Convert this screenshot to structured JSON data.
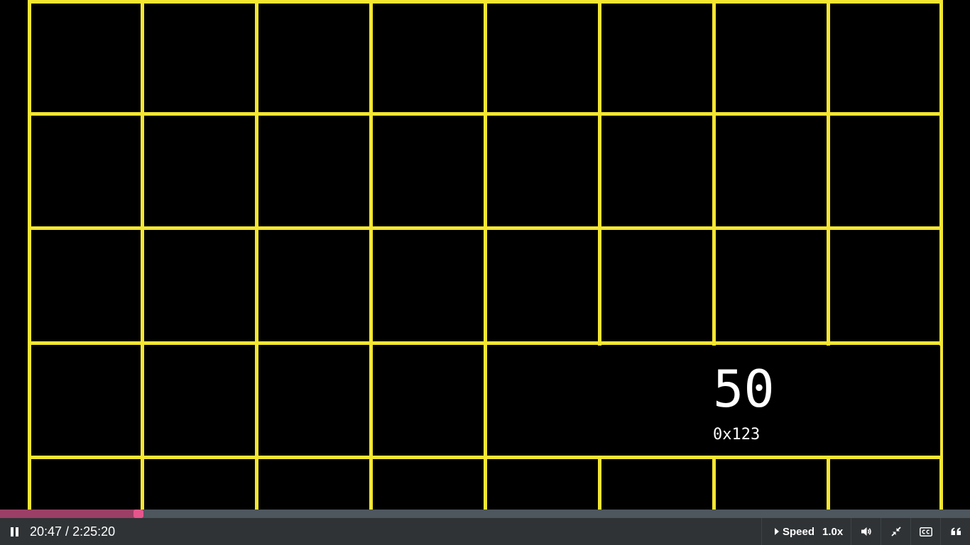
{
  "player": {
    "current_time": "20:47",
    "separator": " / ",
    "duration": "2:25:20",
    "progress_fraction": 0.1429,
    "speed_label": "Speed",
    "speed_value": "1.0x"
  },
  "video_frame": {
    "cell_value": "50",
    "cell_address": "0x123",
    "grid_color": "#f4e631"
  },
  "colors": {
    "progress_played": "#9b3f66",
    "progress_knob": "#e5568c",
    "progress_track": "#4e565e",
    "control_bar": "#2f3336"
  },
  "icons": {
    "play_pause": "pause-icon",
    "volume": "volume-icon",
    "exit_fullscreen": "exit-fullscreen-icon",
    "captions": "closed-captions-icon",
    "transcript": "quote-icon",
    "speed": "triangle-right-icon"
  }
}
